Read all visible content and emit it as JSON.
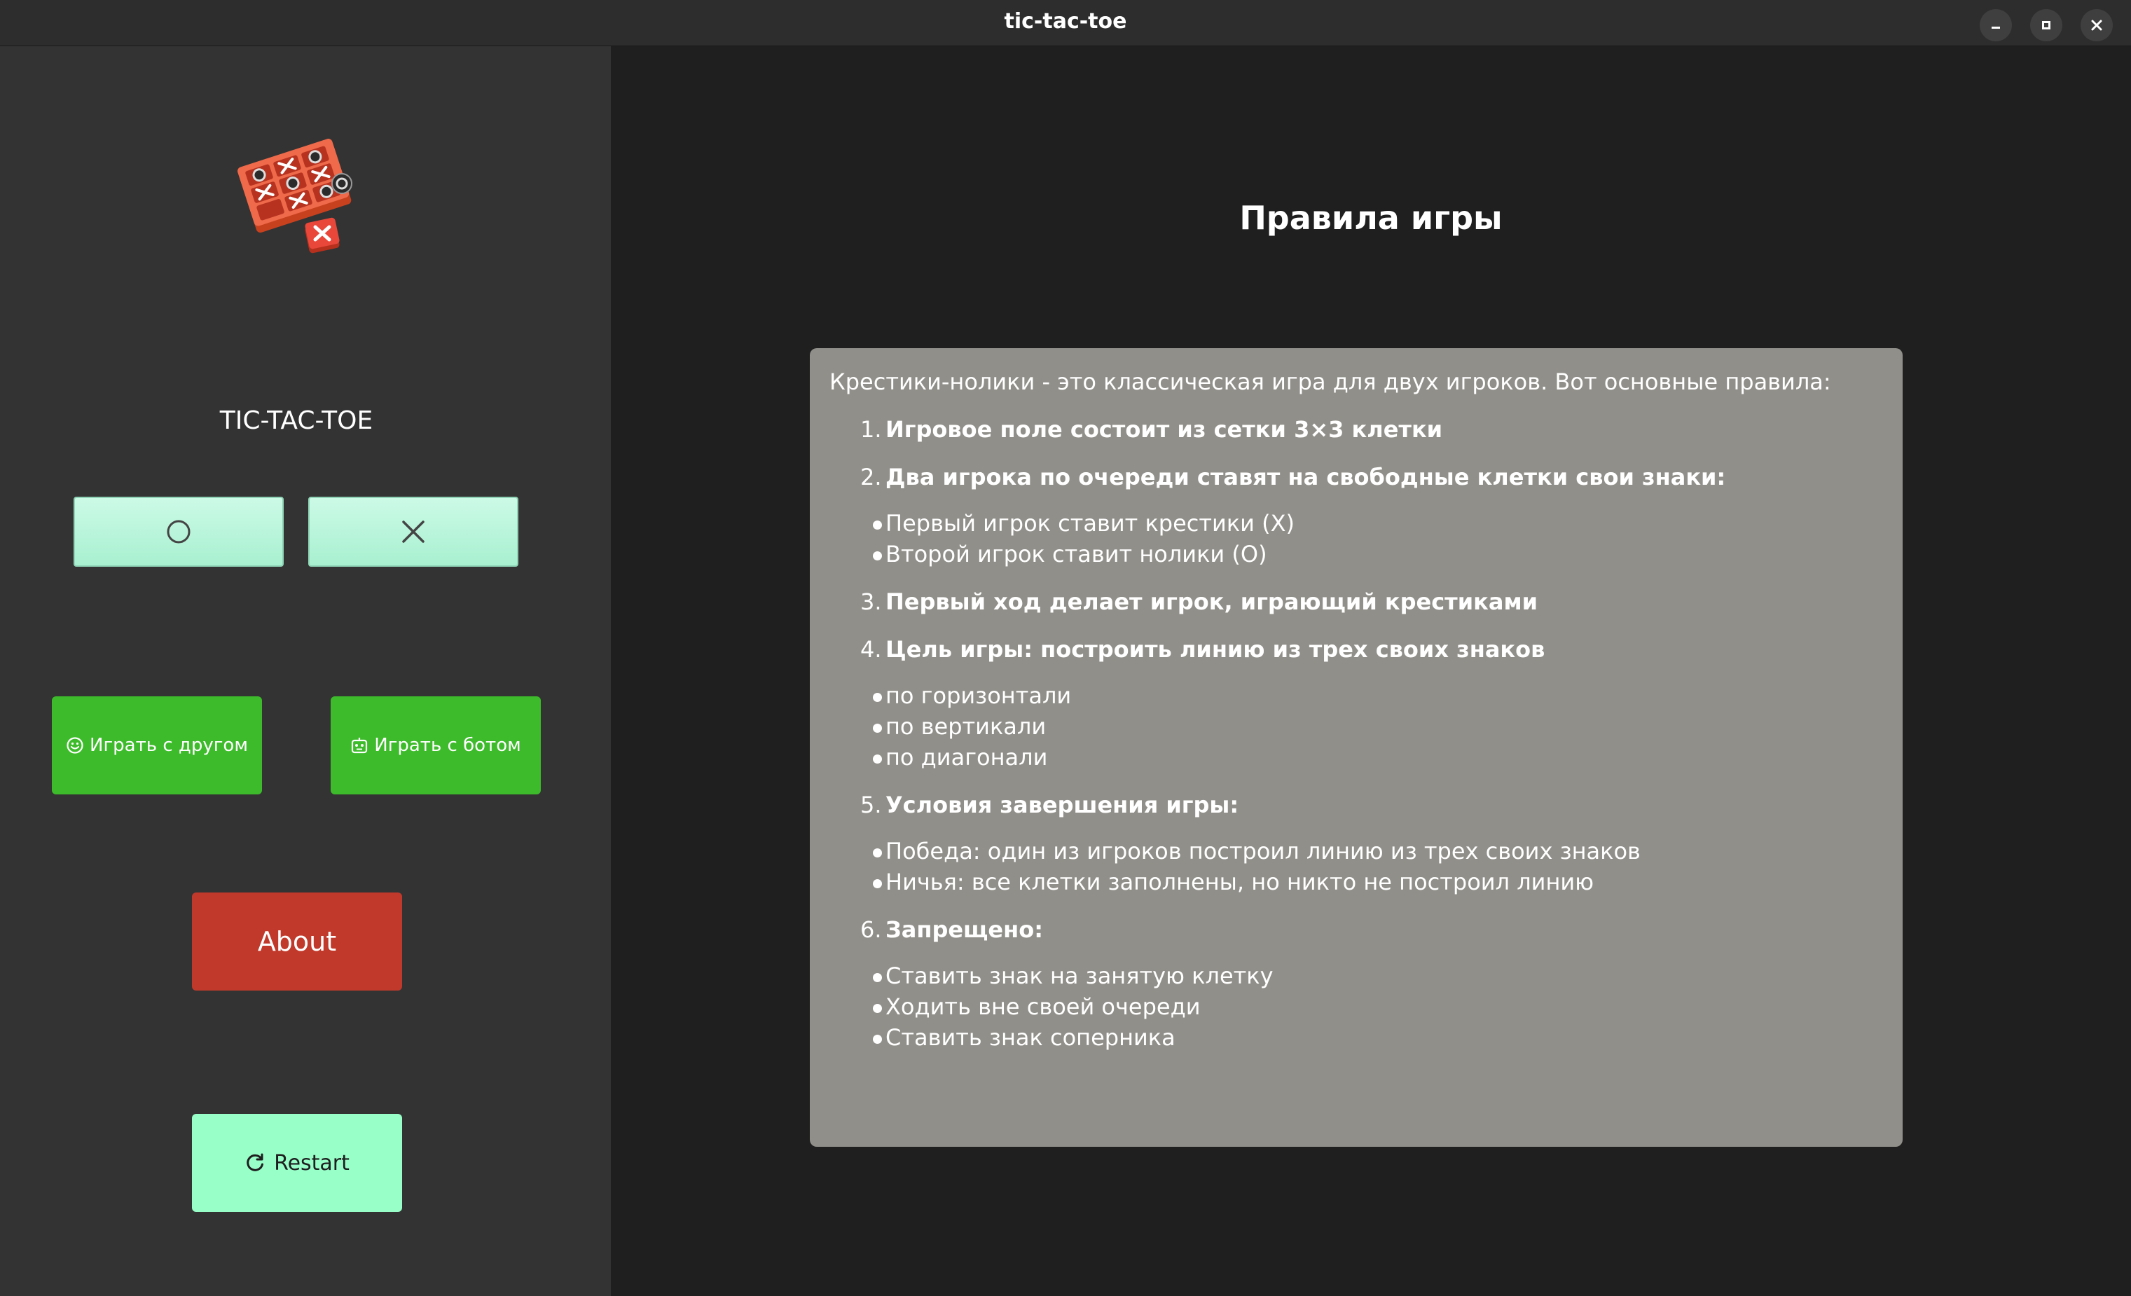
{
  "window": {
    "title": "tic-tac-toe",
    "controls": [
      "minimize-icon",
      "maximize-icon",
      "close-icon"
    ]
  },
  "sidebar": {
    "app_name": "TIC-TAC-TOE",
    "symbols": {
      "o_icon": "circle-icon",
      "x_icon": "cross-icon"
    },
    "play_friend_label": "Играть с другом",
    "play_bot_label": "Играть с ботом",
    "about_label": "About",
    "restart_label": "Restart"
  },
  "rules": {
    "title": "Правила игры",
    "intro": "Крестики-нолики - это классическая игра для двух игроков. Вот основные правила:",
    "items": [
      {
        "num": "1.",
        "text": "Игровое поле состоит из сетки 3×3 клетки",
        "bullets": []
      },
      {
        "num": "2.",
        "text": "Два игрока по очереди ставят на свободные клетки свои знаки:",
        "bullets": [
          "Первый игрок ставит крестики (X)",
          "Второй игрок ставит нолики (O)"
        ]
      },
      {
        "num": "3.",
        "text": "Первый ход делает игрок, играющий крестиками",
        "bullets": []
      },
      {
        "num": "4.",
        "text": "Цель игры: построить линию из трех своих знаков",
        "bullets": [
          "по горизонтали",
          "по вертикали",
          "по диагонали"
        ]
      },
      {
        "num": "5.",
        "text": "Условия завершения игры:",
        "bullets": [
          "Победа: один из игроков построил линию из трех своих знаков",
          "Ничья: все клетки заполнены, но никто не построил линию"
        ]
      },
      {
        "num": "6.",
        "text": "Запрещено:",
        "bullets": [
          "Ставить знак на занятую клетку",
          "Ходить вне своей очереди",
          "Ставить знак соперника"
        ]
      }
    ]
  },
  "colors": {
    "sidebar_bg": "#333333",
    "main_bg": "#1f1f1f",
    "symbol_button": "#b8f5da",
    "play_button": "#3dbb2b",
    "about_button": "#c0392b",
    "restart_button": "#98ffc9",
    "rules_panel": "#918f89"
  }
}
